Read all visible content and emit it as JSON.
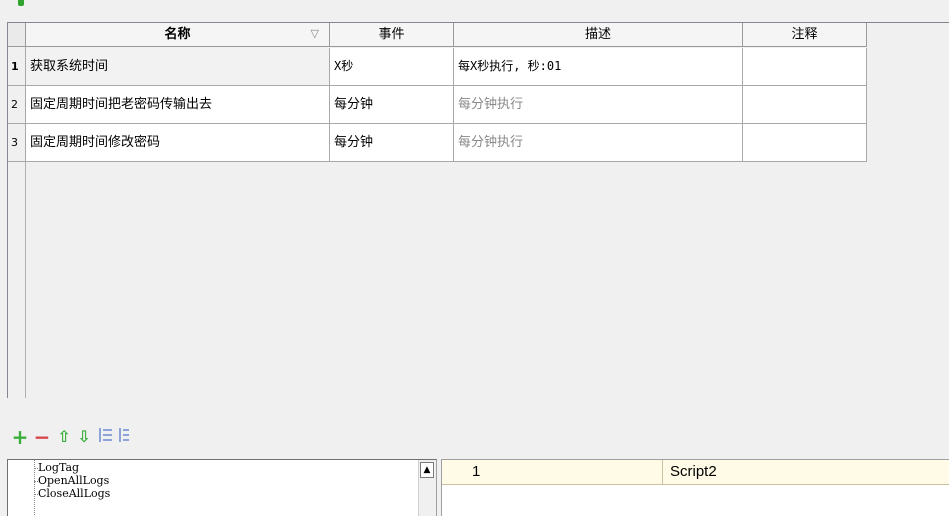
{
  "table": {
    "headers": [
      "名称",
      "事件",
      "描述",
      "注释"
    ],
    "sort_icon": "sort-indicator-icon",
    "rows": [
      {
        "num": "1",
        "name": "获取系统时间",
        "event": "X秒",
        "desc": "每X秒执行, 秒:01",
        "note": ""
      },
      {
        "num": "2",
        "name": "固定周期时间把老密码传输出去",
        "event": "每分钟",
        "desc": "每分钟执行",
        "note": ""
      },
      {
        "num": "3",
        "name": "固定周期时间修改密码",
        "event": "每分钟",
        "desc": "每分钟执行",
        "note": ""
      }
    ]
  },
  "toolbar": {
    "add": "+",
    "remove": "−",
    "up": "⇧",
    "down": "⇩",
    "indent": "⁝",
    "outdent": "⁝"
  },
  "tree": {
    "items": [
      "LogTag",
      "OpenAllLogs",
      "CloseAllLogs"
    ]
  },
  "script_list": {
    "number": "1",
    "name": "Script2"
  },
  "colors": {
    "accent_green": "#3aae3a",
    "accent_red": "#d9434a"
  }
}
